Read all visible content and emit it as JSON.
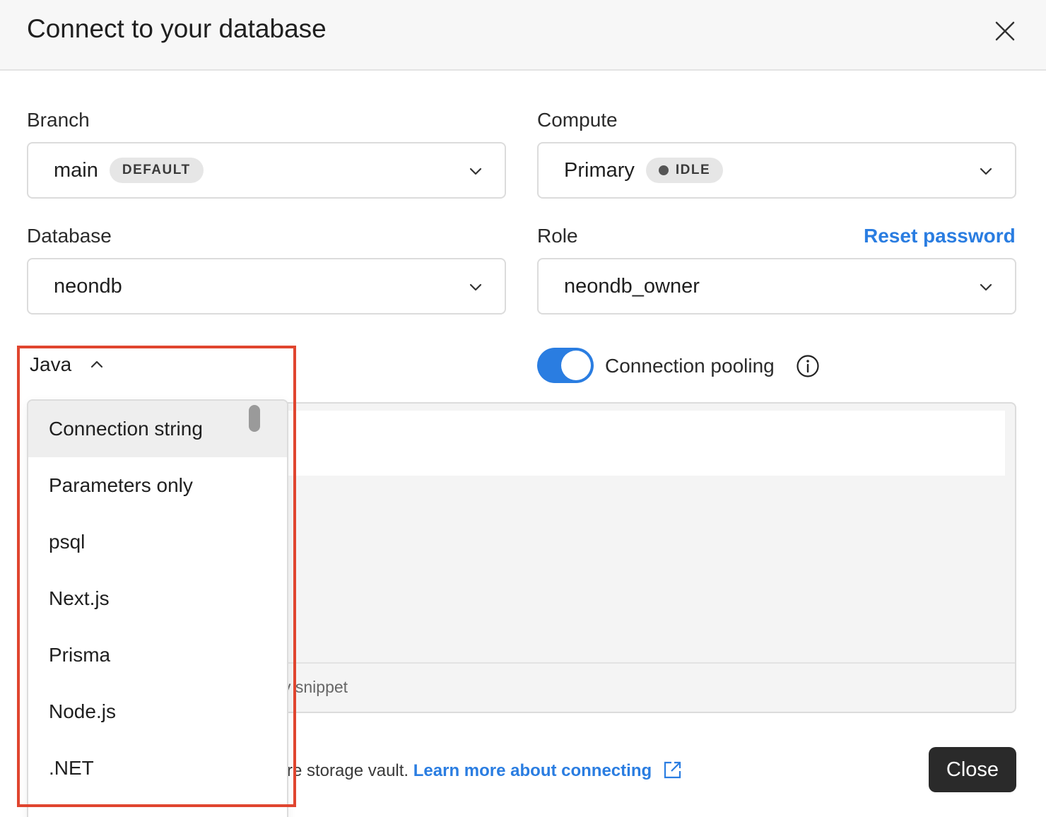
{
  "dialog": {
    "title": "Connect to your database",
    "close_icon": "close-icon"
  },
  "branch": {
    "label": "Branch",
    "value": "main",
    "badge": "DEFAULT"
  },
  "compute": {
    "label": "Compute",
    "value": "Primary",
    "badge": "IDLE"
  },
  "database": {
    "label": "Database",
    "value": "neondb"
  },
  "role": {
    "label": "Role",
    "value": "neondb_owner",
    "reset_link": "Reset password"
  },
  "connection_type": {
    "selected": "Java",
    "options": [
      "Connection string",
      "Parameters only",
      "psql",
      "Next.js",
      "Prisma",
      "Node.js",
      ".NET"
    ],
    "active_option": "Connection string"
  },
  "pooling": {
    "label": "Connection pooling",
    "enabled": true
  },
  "snippet": {
    "copy_label": "y snippet"
  },
  "footer": {
    "note_text": "re storage vault.",
    "learn_more": "Learn more about connecting",
    "close_label": "Close"
  },
  "colors": {
    "accent": "#2a7de1",
    "highlight": "#e0452f",
    "close_button": "#2a2a2a"
  }
}
